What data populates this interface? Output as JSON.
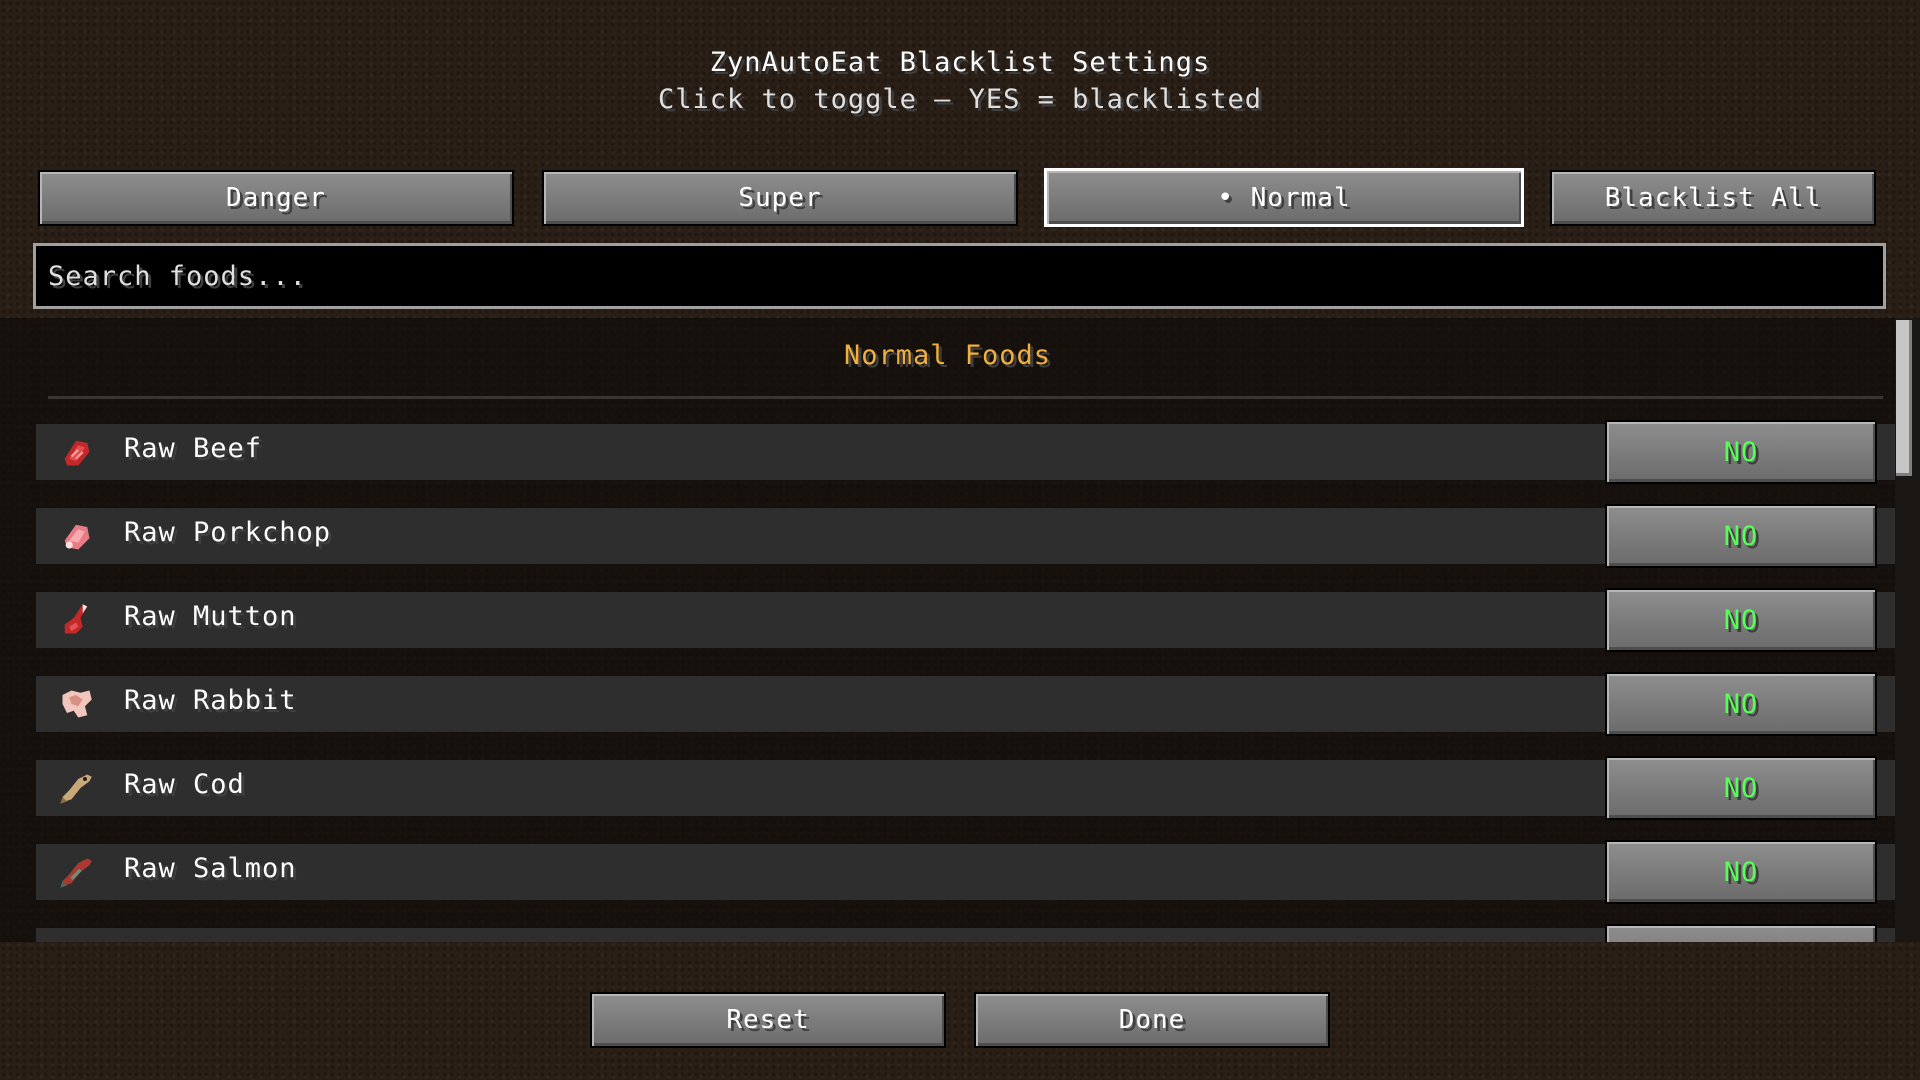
{
  "header": {
    "title": "ZynAutoEat Blacklist Settings",
    "subtitle": "Click to toggle — YES = blacklisted"
  },
  "tabs": [
    {
      "label": "Danger",
      "selected": false
    },
    {
      "label": "Super",
      "selected": false
    },
    {
      "label": "• Normal",
      "selected": true
    },
    {
      "label": "Blacklist All",
      "selected": false
    }
  ],
  "search": {
    "placeholder": "Search foods..."
  },
  "list": {
    "section_title": "Normal Foods",
    "items": [
      {
        "name": "Raw Beef",
        "toggle": "NO",
        "icon": "raw-beef-icon"
      },
      {
        "name": "Raw Porkchop",
        "toggle": "NO",
        "icon": "raw-porkchop-icon"
      },
      {
        "name": "Raw Mutton",
        "toggle": "NO",
        "icon": "raw-mutton-icon"
      },
      {
        "name": "Raw Rabbit",
        "toggle": "NO",
        "icon": "raw-rabbit-icon"
      },
      {
        "name": "Raw Cod",
        "toggle": "NO",
        "icon": "raw-cod-icon"
      },
      {
        "name": "Raw Salmon",
        "toggle": "NO",
        "icon": "raw-salmon-icon"
      }
    ]
  },
  "footer": {
    "reset_label": "Reset",
    "done_label": "Done"
  },
  "colors": {
    "toggle_no": "#55ff55",
    "section_title": "#f0b040",
    "button_face": "#7b7b7b"
  }
}
